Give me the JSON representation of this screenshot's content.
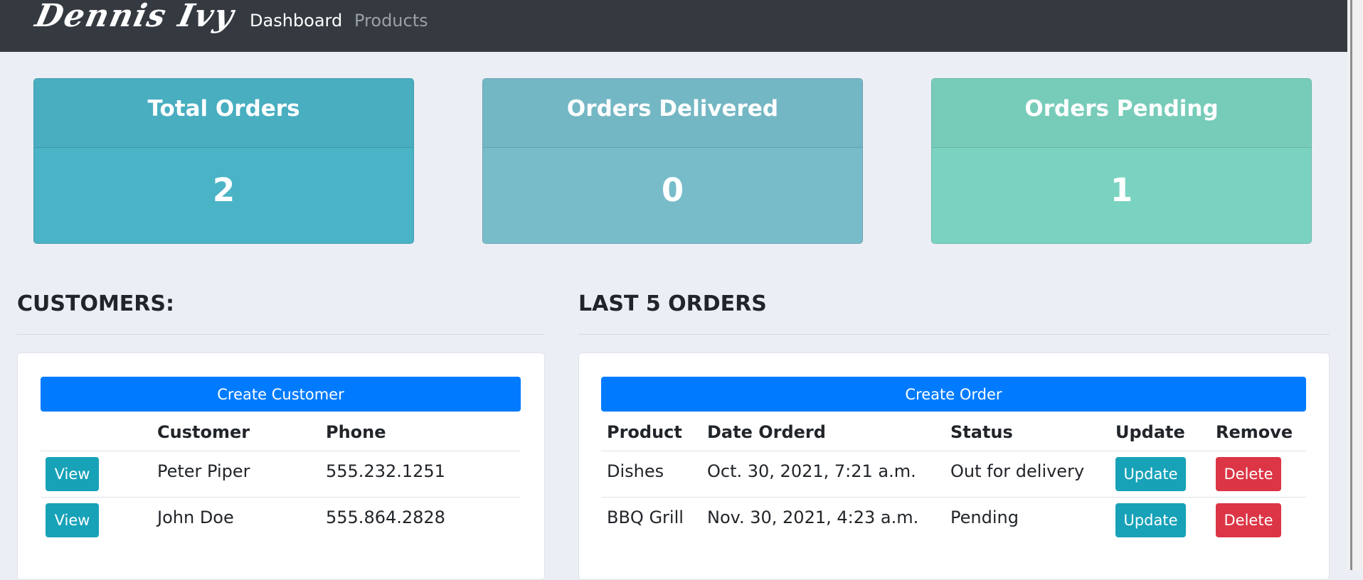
{
  "navbar": {
    "brand": "Dennis Ivy",
    "links": [
      {
        "label": "Dashboard",
        "active": true
      },
      {
        "label": "Products",
        "active": false
      }
    ]
  },
  "stats": [
    {
      "title": "Total Orders",
      "value": "2",
      "color": "#4ab3c5"
    },
    {
      "title": "Orders Delivered",
      "value": "0",
      "color": "#78bcca"
    },
    {
      "title": "Orders Pending",
      "value": "1",
      "color": "#7ad3c1"
    }
  ],
  "customers": {
    "title": "CUSTOMERS:",
    "create_label": "Create Customer",
    "columns": [
      "",
      "Customer",
      "Phone"
    ],
    "rows": [
      {
        "action": "View",
        "name": "Peter Piper",
        "phone": "555.232.1251"
      },
      {
        "action": "View",
        "name": "John Doe",
        "phone": "555.864.2828"
      }
    ]
  },
  "orders": {
    "title": "LAST 5 ORDERS",
    "create_label": "Create Order",
    "columns": [
      "Product",
      "Date Orderd",
      "Status",
      "Update",
      "Remove"
    ],
    "rows": [
      {
        "product": "Dishes",
        "date": "Oct. 30, 2021, 7:21 a.m.",
        "status": "Out for delivery",
        "update": "Update",
        "remove": "Delete"
      },
      {
        "product": "BBQ Grill",
        "date": "Nov. 30, 2021, 4:23 a.m.",
        "status": "Pending",
        "update": "Update",
        "remove": "Delete"
      }
    ]
  },
  "colors": {
    "navbar": "#343a40",
    "primary": "#007bff",
    "info": "#17a2b8",
    "danger": "#dc3545",
    "background": "#ebeef5"
  }
}
